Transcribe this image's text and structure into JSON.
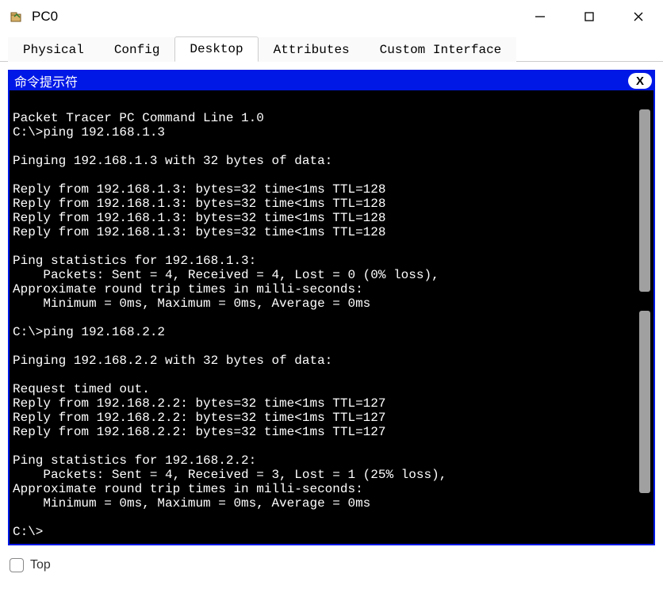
{
  "window": {
    "title": "PC0"
  },
  "tabs": [
    {
      "label": "Physical",
      "active": false
    },
    {
      "label": "Config",
      "active": false
    },
    {
      "label": "Desktop",
      "active": true
    },
    {
      "label": "Attributes",
      "active": false
    },
    {
      "label": "Custom Interface",
      "active": false
    }
  ],
  "terminal": {
    "title": "命令提示符",
    "close": "X",
    "lines": [
      "",
      "Packet Tracer PC Command Line 1.0",
      "C:\\>ping 192.168.1.3",
      "",
      "Pinging 192.168.1.3 with 32 bytes of data:",
      "",
      "Reply from 192.168.1.3: bytes=32 time<1ms TTL=128",
      "Reply from 192.168.1.3: bytes=32 time<1ms TTL=128",
      "Reply from 192.168.1.3: bytes=32 time<1ms TTL=128",
      "Reply from 192.168.1.3: bytes=32 time<1ms TTL=128",
      "",
      "Ping statistics for 192.168.1.3:",
      "    Packets: Sent = 4, Received = 4, Lost = 0 (0% loss),",
      "Approximate round trip times in milli-seconds:",
      "    Minimum = 0ms, Maximum = 0ms, Average = 0ms",
      "",
      "C:\\>ping 192.168.2.2",
      "",
      "Pinging 192.168.2.2 with 32 bytes of data:",
      "",
      "Request timed out.",
      "Reply from 192.168.2.2: bytes=32 time<1ms TTL=127",
      "Reply from 192.168.2.2: bytes=32 time<1ms TTL=127",
      "Reply from 192.168.2.2: bytes=32 time<1ms TTL=127",
      "",
      "Ping statistics for 192.168.2.2:",
      "    Packets: Sent = 4, Received = 3, Lost = 1 (25% loss),",
      "Approximate round trip times in milli-seconds:",
      "    Minimum = 0ms, Maximum = 0ms, Average = 0ms",
      "",
      "C:\\>"
    ]
  },
  "bottom": {
    "top_label": "Top"
  }
}
